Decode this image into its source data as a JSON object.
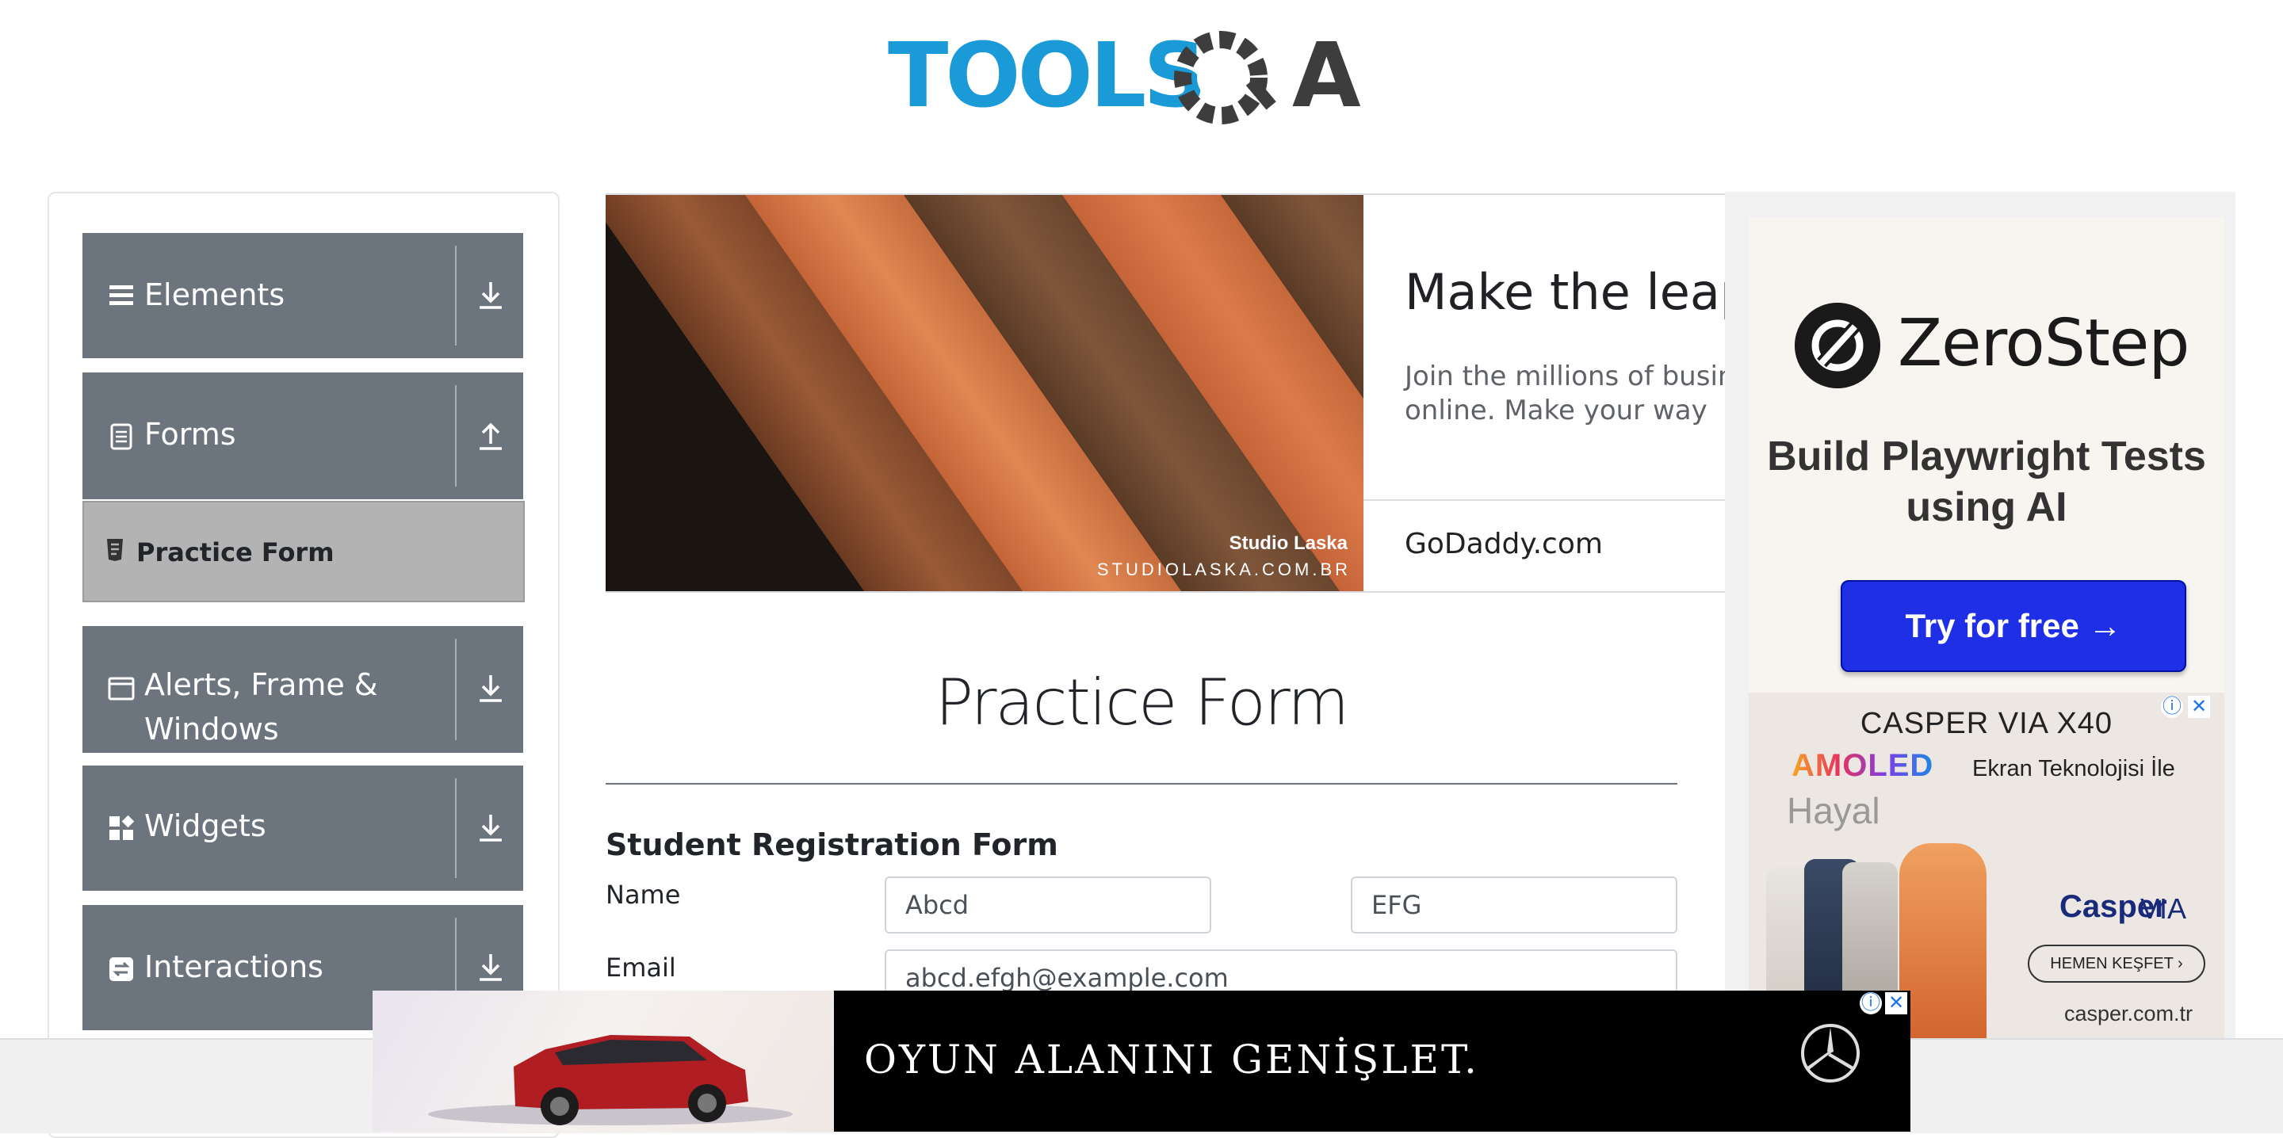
{
  "logo": {
    "text": "TOOLSQA"
  },
  "sidebar": {
    "groups": [
      {
        "label": "Elements",
        "icon": "hamburger-icon",
        "state": "collapsed"
      },
      {
        "label": "Forms",
        "icon": "document-icon",
        "state": "expanded"
      },
      {
        "label": "Alerts, Frame &",
        "label2": "Windows",
        "icon": "window-icon",
        "state": "collapsed"
      },
      {
        "label": "Widgets",
        "icon": "widgets-icon",
        "state": "collapsed"
      },
      {
        "label": "Interactions",
        "icon": "interactions-icon",
        "state": "collapsed"
      }
    ],
    "active_item": {
      "label": "Practice Form",
      "icon": "form-icon"
    }
  },
  "top_ad": {
    "headline": "Make the leap w",
    "description": "Join the millions of busine be online. Make your way",
    "domain": "GoDaddy.com",
    "image_caption": "Studio Laska",
    "image_url_text": "STUDIOLASKA.COM.BR"
  },
  "right_ad": {
    "zerostep": {
      "brand": "ZeroStep",
      "headline": "Build Playwright Tests using AI",
      "cta": "Try for free →",
      "button_color": "#1f2fe6"
    },
    "casper": {
      "line1": "CASPER VIA X40",
      "amoled": "AMOLED",
      "line2": "Ekran Teknolojisi İle",
      "line3": "Hayal",
      "brand": "Casper",
      "brand2": "VIA",
      "cta": "HEMEN KEŞFET",
      "url": "casper.com.tr"
    }
  },
  "main": {
    "title": "Practice Form",
    "subtitle": "Student Registration Form",
    "fields": {
      "name_label": "Name",
      "first_name_value": "Abcd",
      "last_name_value": "EFG",
      "email_label": "Email",
      "email_value": "abcd.efgh@example.com"
    }
  },
  "bottom_ad": {
    "text": "OYUN ALANINI GENİŞLET."
  },
  "colors": {
    "sidebar_group_bg": "#6c757d",
    "active_item_bg": "#b3b3b3",
    "logo_blue": "#1a9bd7",
    "logo_dark": "#3d3d3d"
  }
}
